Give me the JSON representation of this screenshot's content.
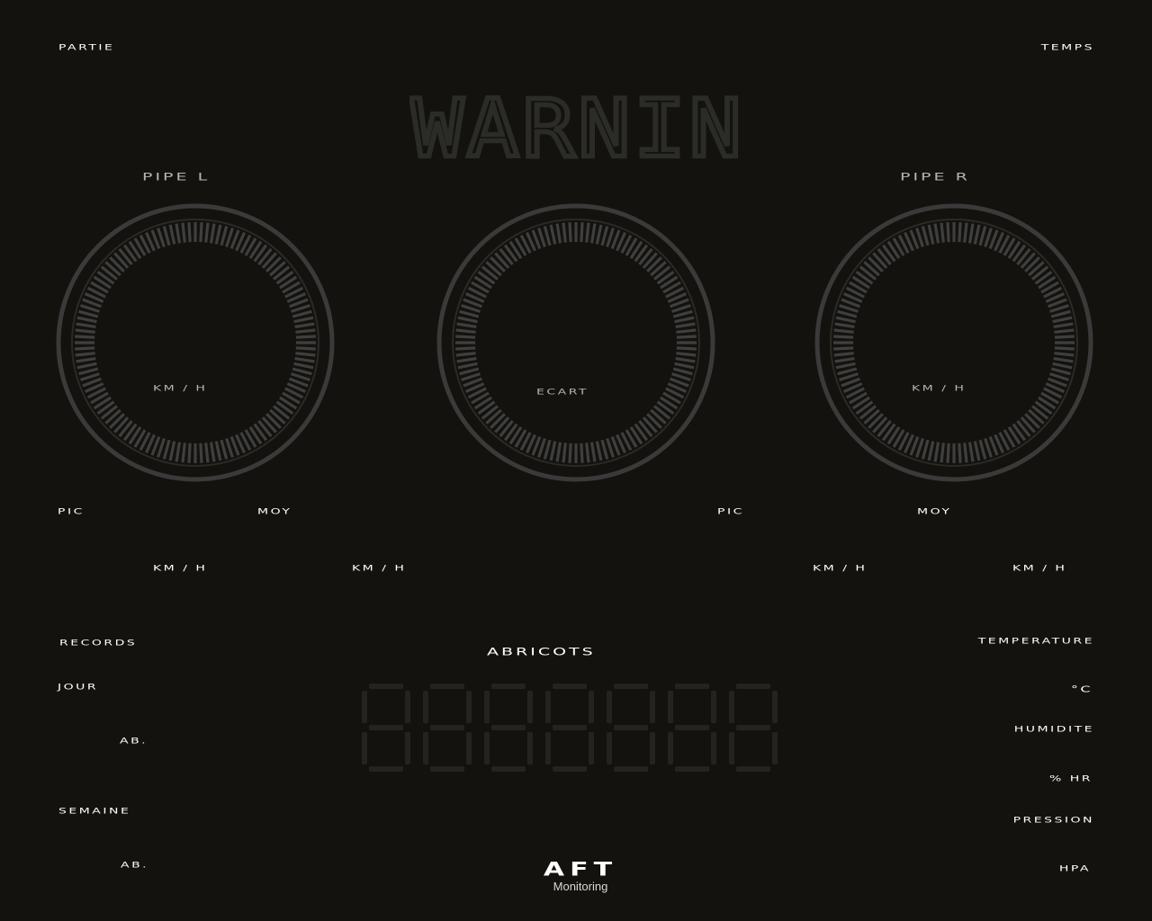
{
  "header": {
    "partie": "PARTIE",
    "temps": "TEMPS"
  },
  "warning": {
    "text": "WARNING",
    "color": "#2a2a26"
  },
  "gauges": {
    "left": {
      "title": "PIPE L",
      "unit": "KM / H"
    },
    "center": {
      "unit": "ECART"
    },
    "right": {
      "title": "PIPE R",
      "unit": "KM / H"
    }
  },
  "stats_left": {
    "pic": "PIC",
    "moy": "MOY",
    "pic_unit": "KM / H",
    "moy_unit": "KM / H"
  },
  "stats_right": {
    "pic": "PIC",
    "moy": "MOY",
    "pic_unit": "KM / H",
    "moy_unit": "KM / H"
  },
  "records": {
    "title": "RECORDS",
    "jour": "JOUR",
    "jour_unit": "AB.",
    "semaine": "SEMAINE",
    "semaine_unit": "AB."
  },
  "counter": {
    "title": "ABRICOTS",
    "digits": "8888888",
    "segment_color": "#24241f"
  },
  "environment": {
    "temperature": "TEMPERATURE",
    "temperature_unit": "°C",
    "humidite": "HUMIDITE",
    "humidite_unit": "% HR",
    "pression": "PRESSION",
    "pression_unit": "HPA"
  },
  "brand": {
    "logo": "AFT",
    "subtitle": "Monitoring"
  },
  "colors": {
    "background": "#13120e",
    "ring": "#3a3a3a",
    "ticks": "#3f3f3f",
    "text": "#ffffff",
    "dim_text": "#b5b5b5"
  }
}
